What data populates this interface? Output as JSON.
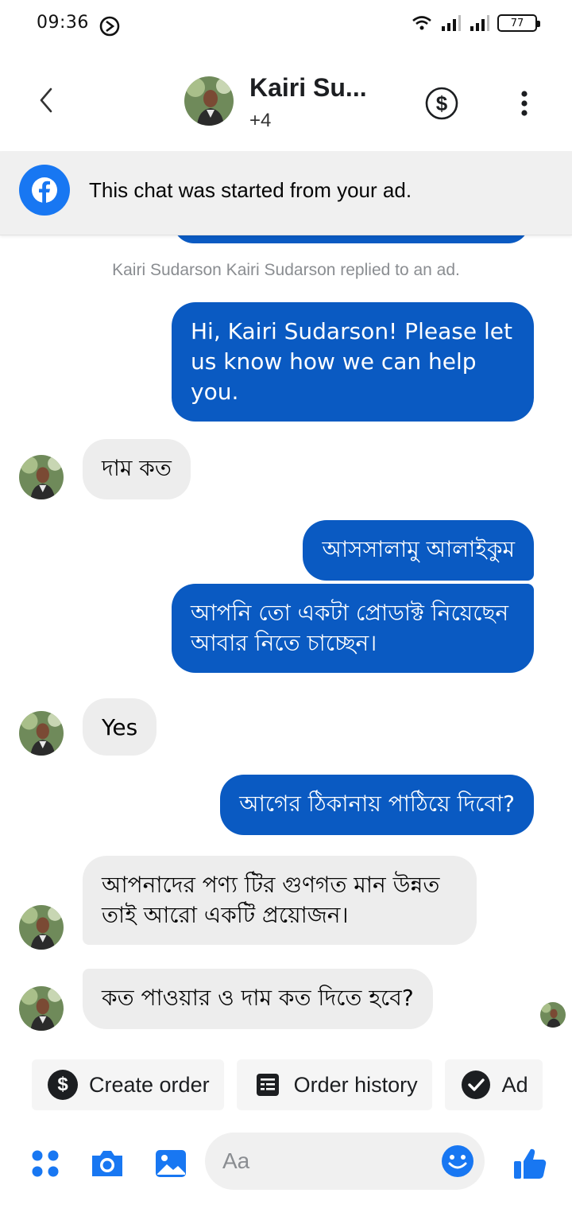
{
  "status_bar": {
    "time": "09:36",
    "battery": "77"
  },
  "header": {
    "contact_name": "Kairi Su...",
    "subtitle": "+4"
  },
  "ad_banner": {
    "text": "This chat was started from your ad."
  },
  "chat": {
    "system_note": "Kairi Sudarson Kairi Sudarson replied to an ad.",
    "messages": [
      {
        "direction": "outgoing",
        "text": "Hi, Kairi Sudarson! Please let us know how we can help you."
      },
      {
        "direction": "incoming",
        "text": "দাম কত"
      },
      {
        "direction": "outgoing",
        "text": "আসসালামু আলাইকুম"
      },
      {
        "direction": "outgoing",
        "text": "আপনি তো একটা প্রোডাক্ট নিয়েছেন আবার নিতে চাচ্ছেন।"
      },
      {
        "direction": "incoming",
        "text": "Yes"
      },
      {
        "direction": "outgoing",
        "text": "আগের ঠিকানায় পাঠিয়ে দিবো?"
      },
      {
        "direction": "incoming",
        "text": "আপনাদের পণ্য টির গুণগত মান উন্নত তাই  আরো একটি প্রয়োজন।"
      },
      {
        "direction": "incoming",
        "text": "কত পাওয়ার ও দাম কত দিতে হবে?"
      }
    ]
  },
  "quick_replies": [
    {
      "label": "Create order",
      "icon": "dollar-icon"
    },
    {
      "label": "Order history",
      "icon": "receipt-icon"
    },
    {
      "label": "Ad",
      "icon": "check-icon"
    }
  ],
  "composer": {
    "placeholder": "Aa"
  },
  "colors": {
    "outgoing_bubble": "#0a5ac2",
    "incoming_bubble": "#ededed",
    "accent": "#1877f2"
  }
}
